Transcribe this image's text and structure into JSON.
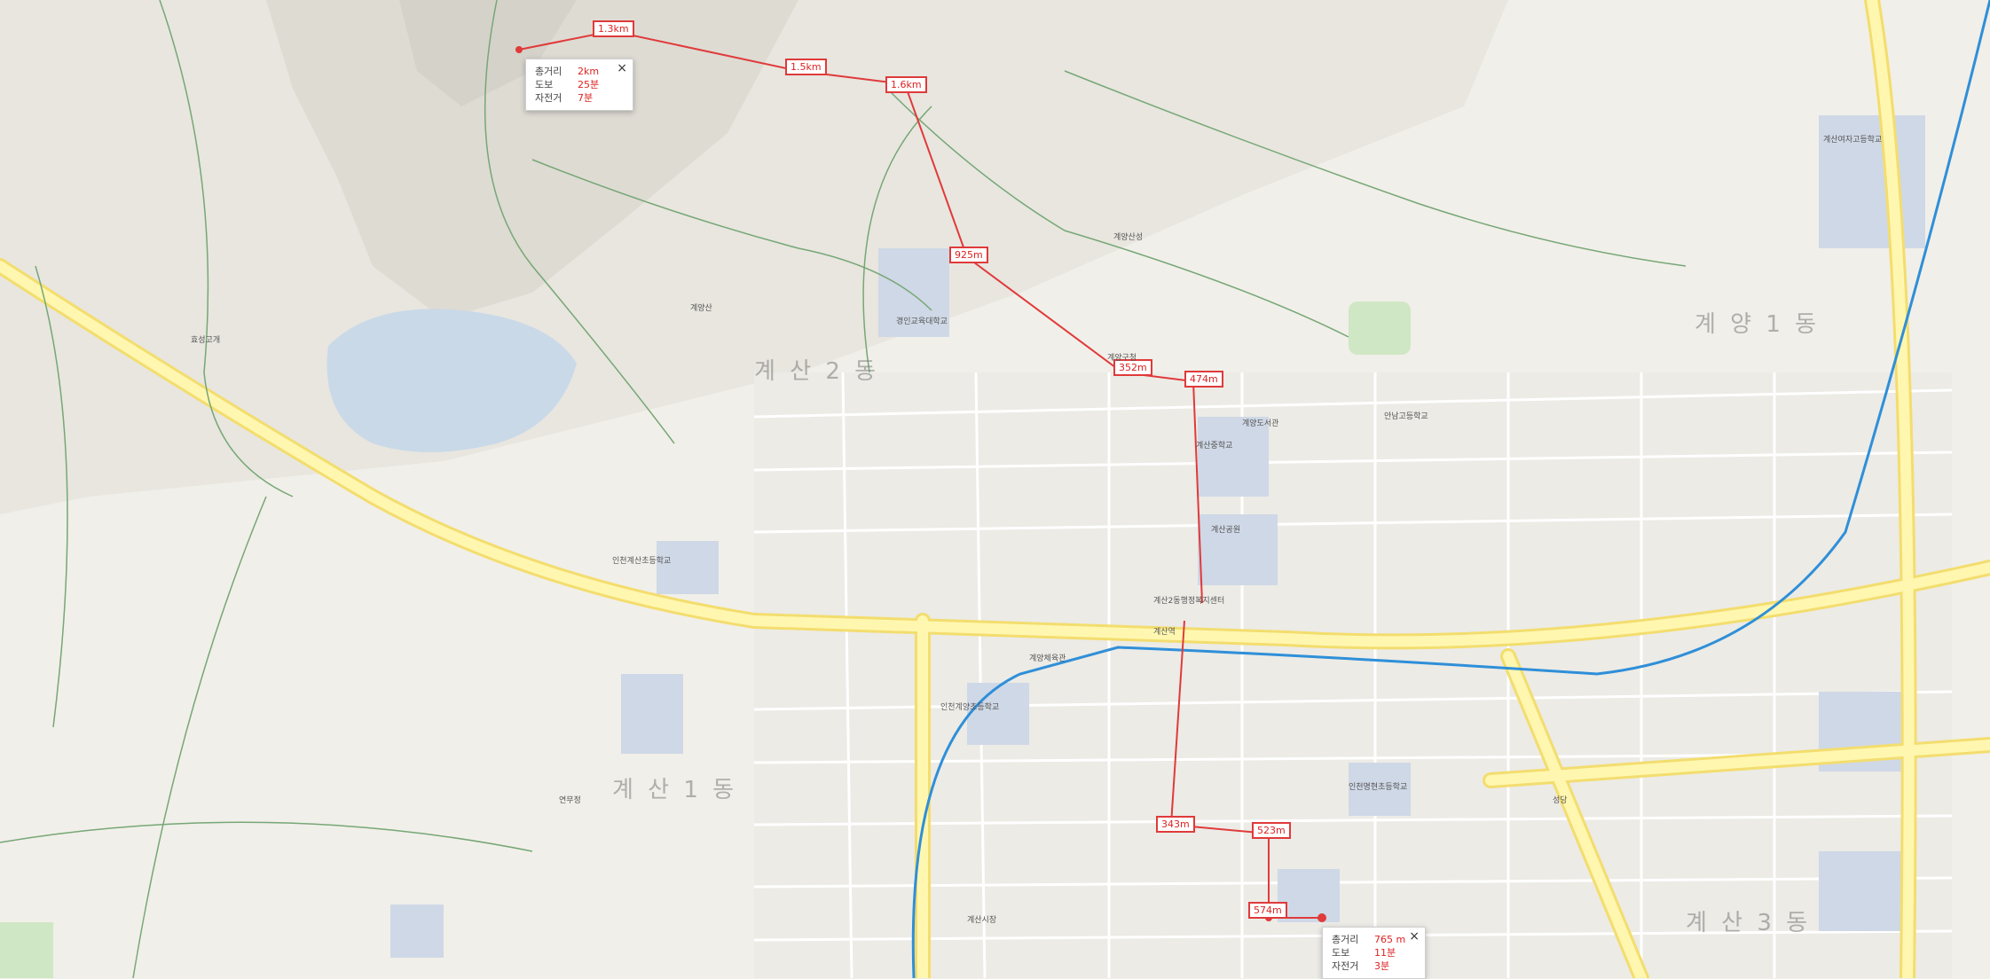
{
  "map": {
    "region_labels": [
      {
        "text": "계 산 2 동"
      },
      {
        "text": "계 산 1 동"
      },
      {
        "text": "계 양 1 동"
      },
      {
        "text": "계 산 3 동"
      }
    ],
    "top_route": {
      "segments": [
        "1.3km",
        "1.5km",
        "1.6km",
        "925m",
        "352m",
        "474m"
      ],
      "popup": {
        "rows": [
          {
            "key": "총거리",
            "value": "2km"
          },
          {
            "key": "도보",
            "value": "25분"
          },
          {
            "key": "자전거",
            "value": "7분"
          }
        ]
      }
    },
    "bottom_route": {
      "segments": [
        "343m",
        "523m",
        "574m"
      ],
      "popup": {
        "rows": [
          {
            "key": "총거리",
            "value": "765 m"
          },
          {
            "key": "도보",
            "value": "11분"
          },
          {
            "key": "자전거",
            "value": "3분"
          }
        ]
      }
    },
    "pois": [
      "계양산",
      "계양구청",
      "계산역",
      "계양산성",
      "인천계산초등학교",
      "경인교육대학교",
      "계산중학교",
      "계산공원",
      "효성고개",
      "계양도서관",
      "계산2동행정복지센터",
      "인천계양초등학교",
      "계산여자고등학교",
      "안남고등학교",
      "인천명현초등학교",
      "연무정",
      "계양체육관",
      "성당",
      "계산시장"
    ],
    "colors": {
      "route": "#e03a3a",
      "subway": "#2f8fd8",
      "road": "#fff7b0",
      "park": "#cfe7c4"
    }
  }
}
